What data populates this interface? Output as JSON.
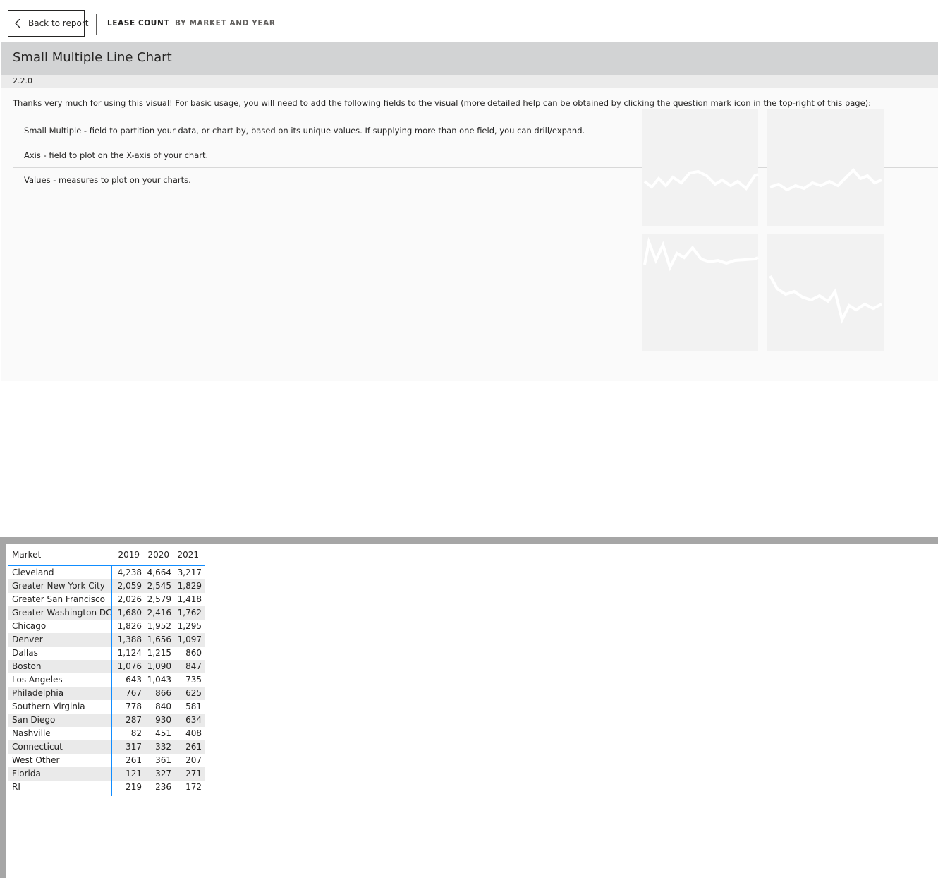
{
  "nav": {
    "back_label": "Back to report",
    "crumbs": [
      "LEASE COUNT",
      "BY MARKET AND YEAR"
    ]
  },
  "landing": {
    "title": "Small Multiple Line Chart",
    "version": "2.2.0",
    "intro": "Thanks very much for using this visual! For basic usage, you will need to add the following fields to the visual (more detailed help can be obtained by clicking the question mark icon in the top-right of this page):",
    "fields": [
      "Small Multiple - field to partition your data, or chart by, based on its unique values. If supplying more than one field, you can drill/expand.",
      "Axis - field to plot on the X-axis of your chart.",
      "Values - measures to plot on your charts."
    ]
  },
  "table": {
    "headers": [
      "Market",
      "2019",
      "2020",
      "2021"
    ],
    "rows": [
      {
        "market": "Cleveland",
        "y2019": "4,238",
        "y2020": "4,664",
        "y2021": "3,217"
      },
      {
        "market": "Greater New York City",
        "y2019": "2,059",
        "y2020": "2,545",
        "y2021": "1,829"
      },
      {
        "market": "Greater San Francisco",
        "y2019": "2,026",
        "y2020": "2,579",
        "y2021": "1,418"
      },
      {
        "market": "Greater Washington DC",
        "y2019": "1,680",
        "y2020": "2,416",
        "y2021": "1,762"
      },
      {
        "market": "Chicago",
        "y2019": "1,826",
        "y2020": "1,952",
        "y2021": "1,295"
      },
      {
        "market": "Denver",
        "y2019": "1,388",
        "y2020": "1,656",
        "y2021": "1,097"
      },
      {
        "market": "Dallas",
        "y2019": "1,124",
        "y2020": "1,215",
        "y2021": "860"
      },
      {
        "market": "Boston",
        "y2019": "1,076",
        "y2020": "1,090",
        "y2021": "847"
      },
      {
        "market": "Los Angeles",
        "y2019": "643",
        "y2020": "1,043",
        "y2021": "735"
      },
      {
        "market": "Philadelphia",
        "y2019": "767",
        "y2020": "866",
        "y2021": "625"
      },
      {
        "market": "Southern Virginia",
        "y2019": "778",
        "y2020": "840",
        "y2021": "581"
      },
      {
        "market": "San Diego",
        "y2019": "287",
        "y2020": "930",
        "y2021": "634"
      },
      {
        "market": "Nashville",
        "y2019": "82",
        "y2020": "451",
        "y2021": "408"
      },
      {
        "market": "Connecticut",
        "y2019": "317",
        "y2020": "332",
        "y2021": "261"
      },
      {
        "market": "West Other",
        "y2019": "261",
        "y2020": "361",
        "y2021": "207"
      },
      {
        "market": "Florida",
        "y2019": "121",
        "y2020": "327",
        "y2021": "271"
      },
      {
        "market": "RI",
        "y2019": "219",
        "y2020": "236",
        "y2021": "172"
      }
    ]
  },
  "colors": {
    "accent_line": "#118dff",
    "title_band": "#d2d3d4",
    "frame_gray": "#a6a6a6"
  }
}
